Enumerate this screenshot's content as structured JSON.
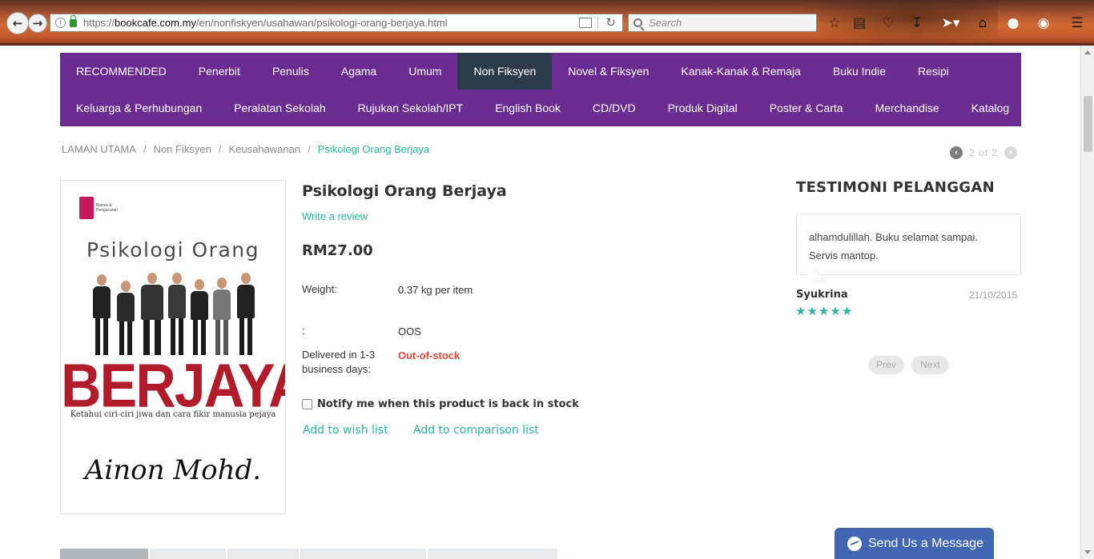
{
  "browser": {
    "url_host": "bookcafe.com.my",
    "url_prefix": "https://",
    "url_path": "/en/nonfiskyen/usahawan/psikologi-orang-berjaya.html",
    "search_placeholder": "Search"
  },
  "nav": {
    "row1": [
      "RECOMMENDED",
      "Penerbit",
      "Penulis",
      "Agama",
      "Umum",
      "Non Fiksyen",
      "Novel & Fiksyen",
      "Kanak-Kanak & Remaja",
      "Buku Indie",
      "Resipi"
    ],
    "row2": [
      "Keluarga & Perhubungan",
      "Peralatan Sekolah",
      "Rujukan Sekolah/IPT",
      "English Book",
      "CD/DVD",
      "Produk Digital",
      "Poster & Carta",
      "Merchandise",
      "Katalog"
    ],
    "active": "Non Fiksyen"
  },
  "breadcrumb": {
    "home": "LAMAN UTAMA",
    "level1": "Non Fiksyen",
    "level2": "Keusahawanan",
    "current": "Psikologi Orang Berjaya",
    "separator": "/"
  },
  "pager": {
    "current": "2",
    "of": "of",
    "total": "2"
  },
  "book_cover": {
    "publisher_line1": "Bisnes &",
    "publisher_line2": "Pengurusan",
    "title_top": "Psikologi Orang",
    "title_main": "BERJAYA",
    "tagline": "Ketahui ciri-ciri jiwa dan cara fikir manusia pejaya",
    "author": "Ainon Mohd."
  },
  "product": {
    "title": "Psikologi Orang Berjaya",
    "review_link": "Write a review",
    "price": "RM27.00",
    "weight_label": "Weight:",
    "weight_value": "0.37 kg per item",
    "stock_label": ":",
    "stock_value": "OOS",
    "delivery_label_1": "Delivered in 1-3",
    "delivery_label_2": "business days:",
    "delivery_value": "Out-of-stock",
    "notify_label": "Notify me when this product is back in stock",
    "wishlist_link": "Add to wish list",
    "compare_link": "Add to comparison list"
  },
  "testimonials": {
    "heading": "TESTIMONI PELANGGAN",
    "text_line1": "alhamdulillah. Buku selamat sampai.",
    "text_line2": "Servis mantop.",
    "author": "Syukrina",
    "date": "21/10/2015",
    "rating": 5,
    "prev": "Prev",
    "next": "Next"
  },
  "messenger": {
    "label": "Send Us a Message"
  },
  "colors": {
    "nav_bg": "#6b2c91",
    "nav_active": "#2d3a4a",
    "accent": "#2bb3a0",
    "oos": "#e04a3a",
    "messenger": "#4267b2"
  }
}
